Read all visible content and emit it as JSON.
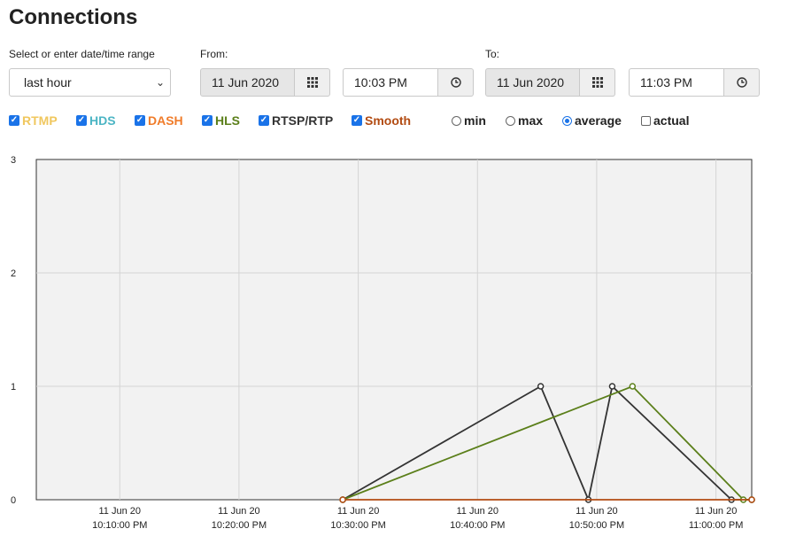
{
  "page_title": "Connections",
  "range": {
    "label": "Select or enter date/time range",
    "value": "last hour"
  },
  "from": {
    "label": "From:",
    "date": "11 Jun 2020",
    "time": "10:03 PM"
  },
  "to": {
    "label": "To:",
    "date": "11 Jun 2020",
    "time": "11:03 PM"
  },
  "protocols": [
    {
      "label": "RTMP",
      "color": "#f0c75e",
      "checked": true
    },
    {
      "label": "HDS",
      "color": "#4cb5c4",
      "checked": true
    },
    {
      "label": "DASH",
      "color": "#f07c2a",
      "checked": true
    },
    {
      "label": "HLS",
      "color": "#5b7f1a",
      "checked": true
    },
    {
      "label": "RTSP/RTP",
      "color": "#333333",
      "checked": true
    },
    {
      "label": "Smooth",
      "color": "#b24b12",
      "checked": true
    }
  ],
  "modes": [
    {
      "label": "min",
      "selected": false
    },
    {
      "label": "max",
      "selected": false
    },
    {
      "label": "average",
      "selected": true
    }
  ],
  "actual": {
    "label": "actual",
    "checked": false
  },
  "chart_data": {
    "type": "line",
    "ylim": [
      0,
      3
    ],
    "y_ticks": [
      "0",
      "1",
      "2",
      "3"
    ],
    "x_ticks": [
      {
        "date": "11 Jun 20",
        "time": "10:10:00 PM",
        "m": 7
      },
      {
        "date": "11 Jun 20",
        "time": "10:20:00 PM",
        "m": 17
      },
      {
        "date": "11 Jun 20",
        "time": "10:30:00 PM",
        "m": 27
      },
      {
        "date": "11 Jun 20",
        "time": "10:40:00 PM",
        "m": 37
      },
      {
        "date": "11 Jun 20",
        "time": "10:50:00 PM",
        "m": 47
      },
      {
        "date": "11 Jun 20",
        "time": "11:00:00 PM",
        "m": 57
      }
    ],
    "grid": true,
    "series": [
      {
        "color": "#333333",
        "points": [
          [
            25.7,
            0
          ],
          [
            42.3,
            1
          ],
          [
            46.3,
            0
          ],
          [
            48.3,
            1
          ],
          [
            58.3,
            0
          ],
          [
            60,
            0
          ]
        ]
      },
      {
        "color": "#5b7f1a",
        "points": [
          [
            25.7,
            0
          ],
          [
            50,
            1
          ],
          [
            59.3,
            0
          ],
          [
            60,
            0
          ]
        ]
      },
      {
        "color": "#b24b12",
        "points": [
          [
            25.7,
            0
          ],
          [
            60,
            0
          ]
        ]
      }
    ]
  }
}
